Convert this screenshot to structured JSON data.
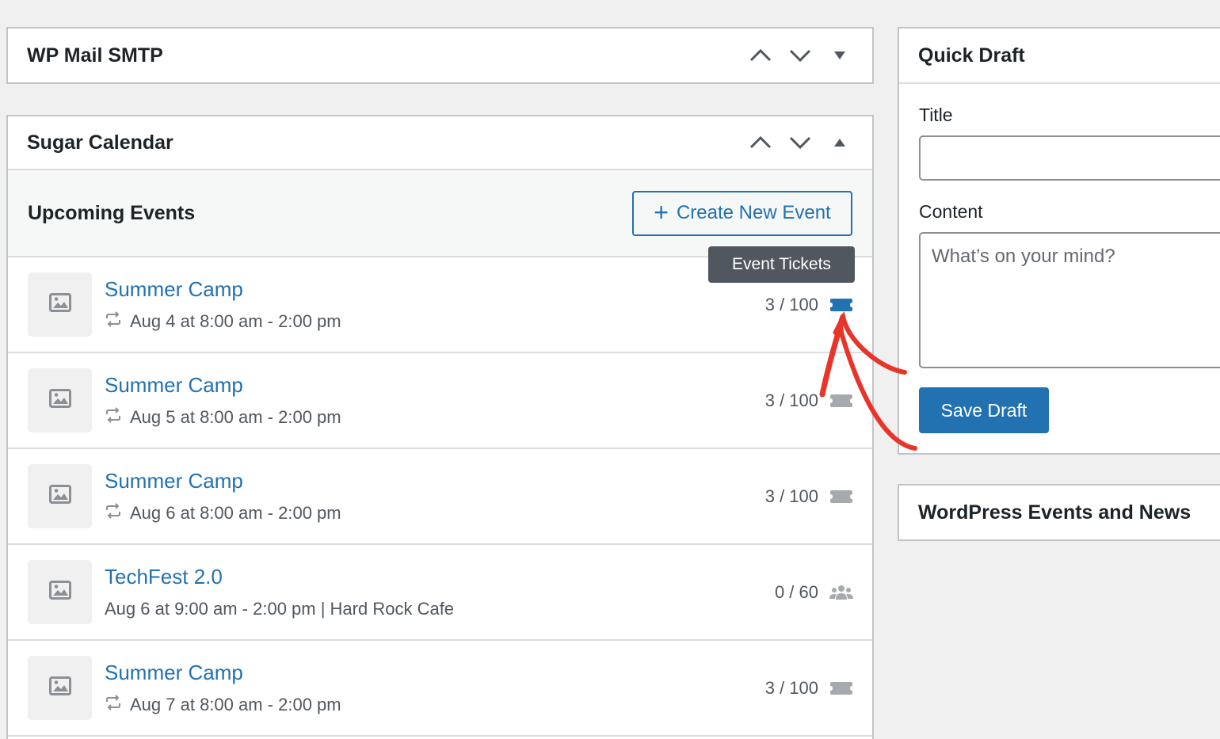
{
  "wp_mail": {
    "title": "WP Mail SMTP"
  },
  "sugar": {
    "title": "Sugar Calendar",
    "upcoming_title": "Upcoming Events",
    "create_label": "Create New Event",
    "tooltip": "Event Tickets",
    "events": [
      {
        "name": "Summer Camp",
        "meta": "Aug 4 at 8:00 am - 2:00 pm",
        "count": "3 / 100",
        "recurring": true,
        "icon": "ticket-icon",
        "icon_color": "#2271b1"
      },
      {
        "name": "Summer Camp",
        "meta": "Aug 5 at 8:00 am - 2:00 pm",
        "count": "3 / 100",
        "recurring": true,
        "icon": "ticket-icon",
        "icon_color": "#a7aaad"
      },
      {
        "name": "Summer Camp",
        "meta": "Aug 6 at 8:00 am - 2:00 pm",
        "count": "3 / 100",
        "recurring": true,
        "icon": "ticket-icon",
        "icon_color": "#a7aaad"
      },
      {
        "name": "TechFest 2.0",
        "meta": "Aug 6 at 9:00 am - 2:00 pm  | Hard Rock Cafe",
        "count": "0 / 60",
        "recurring": false,
        "icon": "attendees-icon",
        "icon_color": "#a7aaad"
      },
      {
        "name": "Summer Camp",
        "meta": "Aug 7 at 8:00 am - 2:00 pm",
        "count": "3 / 100",
        "recurring": true,
        "icon": "ticket-icon",
        "icon_color": "#a7aaad"
      }
    ]
  },
  "quick_draft": {
    "title": "Quick Draft",
    "title_label": "Title",
    "title_value": "",
    "content_label": "Content",
    "content_placeholder": "What’s on your mind?",
    "save_label": "Save Draft"
  },
  "wp_events": {
    "title": "WordPress Events and News"
  },
  "colors": {
    "link": "#2271b1",
    "annotation": "#e8352a"
  }
}
